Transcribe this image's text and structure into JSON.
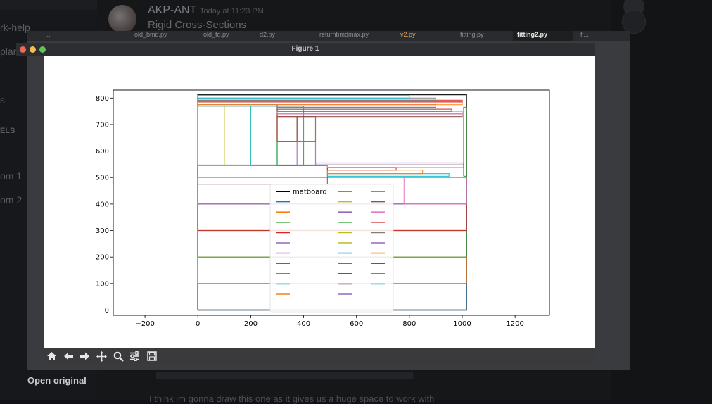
{
  "background": {
    "channels": [
      {
        "label": "rk-help"
      },
      {
        "label": "planni"
      },
      {
        "label": "s"
      },
      {
        "label": "ELS"
      },
      {
        "label": "om 1"
      },
      {
        "label": "om 2"
      }
    ],
    "message": {
      "username": "AKP-ANT",
      "timestamp": "Today at 11:23 PM",
      "text": "Rigid Cross-Sections",
      "followup": "I think im gonna draw this one as it gives us a huge space to work with"
    },
    "open_original": "Open original"
  },
  "editor": {
    "tabs": [
      "...",
      "old_bmd.py",
      "old_fd.py",
      "d2.py",
      "returnbmdmax.py",
      "v2.py",
      "fitting.py",
      "fitting2.py",
      "fi..."
    ]
  },
  "window": {
    "title": "Figure 1",
    "traffic_colors": [
      "#ee6a5f",
      "#f5bf4f",
      "#61c554"
    ]
  },
  "toolbar": {
    "buttons": [
      "home-icon",
      "back-icon",
      "forward-icon",
      "pan-icon",
      "zoom-icon",
      "configure-icon",
      "save-icon"
    ]
  },
  "chart_data": {
    "type": "line",
    "title": "",
    "xlabel": "",
    "ylabel": "",
    "xlim": [
      -320,
      1330
    ],
    "ylim": [
      -20,
      830
    ],
    "xticks": [
      -200,
      0,
      200,
      400,
      600,
      800,
      1000,
      1200
    ],
    "yticks": [
      0,
      100,
      200,
      300,
      400,
      500,
      600,
      700,
      800
    ],
    "legend_placement": "lower center",
    "legend_labels": [
      "matboard"
    ],
    "colors": [
      "#1f77b4",
      "#ff7f0e",
      "#2ca02c",
      "#d62728",
      "#9467bd",
      "#8c564b",
      "#e377c2",
      "#7f7f7f",
      "#bcbd22",
      "#17becf"
    ],
    "series": [
      {
        "name": "matboard",
        "color": "#000000",
        "x": [
          0,
          1016,
          1016,
          0,
          0
        ],
        "y": [
          0,
          0,
          813,
          813,
          0
        ]
      },
      {
        "color": "#1f77b4",
        "x": [
          0,
          1016,
          1016,
          0,
          0
        ],
        "y": [
          0,
          0,
          100,
          100,
          0
        ]
      },
      {
        "color": "#ff7f0e",
        "x": [
          0,
          1016,
          1016,
          0,
          0
        ],
        "y": [
          100,
          100,
          200,
          200,
          100
        ]
      },
      {
        "color": "#2ca02c",
        "x": [
          0,
          1016,
          1016,
          0,
          0
        ],
        "y": [
          200,
          200,
          300,
          300,
          200
        ]
      },
      {
        "color": "#d62728",
        "x": [
          0,
          1016,
          1016,
          0,
          0
        ],
        "y": [
          300,
          300,
          400,
          400,
          300
        ]
      },
      {
        "color": "#9467bd",
        "x": [
          0,
          1016,
          1016,
          0,
          0
        ],
        "y": [
          400,
          400,
          500,
          500,
          400
        ]
      },
      {
        "color": "#e377c2",
        "x": [
          780,
          1016,
          1016,
          780,
          780
        ],
        "y": [
          400,
          400,
          500,
          500,
          400
        ]
      },
      {
        "color": "#8c564b",
        "x": [
          0,
          490,
          490,
          0,
          0
        ],
        "y": [
          475,
          475,
          545,
          545,
          475
        ]
      },
      {
        "color": "#7f7f7f",
        "x": [
          0,
          490,
          490,
          0,
          0
        ],
        "y": [
          545,
          545,
          547,
          547,
          545
        ]
      },
      {
        "color": "#17becf",
        "x": [
          490,
          950,
          950,
          490,
          490
        ],
        "y": [
          505,
          505,
          515,
          515,
          505
        ]
      },
      {
        "color": "#ff7f0e",
        "x": [
          490,
          850,
          850,
          490,
          490
        ],
        "y": [
          515,
          515,
          528,
          528,
          515
        ]
      },
      {
        "color": "#d62728",
        "x": [
          490,
          750,
          750,
          490,
          490
        ],
        "y": [
          528,
          528,
          538,
          538,
          528
        ]
      },
      {
        "color": "#bcbd22",
        "x": [
          490,
          1005,
          1005,
          490,
          490
        ],
        "y": [
          538,
          538,
          548,
          548,
          538
        ]
      },
      {
        "color": "#9467bd",
        "x": [
          450,
          1005,
          1005,
          450,
          450
        ],
        "y": [
          548,
          548,
          555,
          555,
          548
        ]
      },
      {
        "color": "#2ca02c",
        "x": [
          1005,
          1016,
          1016,
          1005,
          1005
        ],
        "y": [
          505,
          505,
          765,
          765,
          505
        ]
      },
      {
        "color": "#bcbd22",
        "x": [
          0,
          100,
          100,
          0,
          0
        ],
        "y": [
          545,
          545,
          770,
          770,
          545
        ]
      },
      {
        "color": "#bcbd22",
        "x": [
          100,
          200,
          200,
          100,
          100
        ],
        "y": [
          545,
          545,
          770,
          770,
          545
        ]
      },
      {
        "color": "#17becf",
        "x": [
          200,
          300,
          300,
          200,
          200
        ],
        "y": [
          545,
          545,
          770,
          770,
          545
        ]
      },
      {
        "color": "#2ca02c",
        "x": [
          300,
          400,
          400,
          300,
          300
        ],
        "y": [
          545,
          545,
          770,
          770,
          545
        ]
      },
      {
        "color": "#d62728",
        "x": [
          300,
          375,
          375,
          300,
          300
        ],
        "y": [
          635,
          635,
          730,
          730,
          635
        ]
      },
      {
        "color": "#8c564b",
        "x": [
          375,
          445,
          445,
          375,
          375
        ],
        "y": [
          635,
          635,
          730,
          730,
          635
        ]
      },
      {
        "color": "#9467bd",
        "x": [
          375,
          445,
          445,
          375,
          375
        ],
        "y": [
          545,
          545,
          635,
          635,
          545
        ]
      },
      {
        "color": "#1f77b4",
        "x": [
          0,
          300,
          300,
          0,
          0
        ],
        "y": [
          770,
          770,
          775,
          775,
          770
        ]
      },
      {
        "color": "#8c564b",
        "x": [
          300,
          1000,
          1000,
          300,
          300
        ],
        "y": [
          730,
          730,
          740,
          740,
          730
        ]
      },
      {
        "color": "#e377c2",
        "x": [
          300,
          1000,
          1000,
          300,
          300
        ],
        "y": [
          740,
          740,
          750,
          750,
          740
        ]
      },
      {
        "color": "#d62728",
        "x": [
          300,
          960,
          960,
          300,
          300
        ],
        "y": [
          750,
          750,
          758,
          758,
          750
        ]
      },
      {
        "color": "#7f7f7f",
        "x": [
          300,
          900,
          900,
          300,
          300
        ],
        "y": [
          758,
          758,
          765,
          765,
          758
        ]
      },
      {
        "color": "#9467bd",
        "x": [
          300,
          900,
          900,
          300,
          300
        ],
        "y": [
          765,
          765,
          775,
          775,
          765
        ]
      },
      {
        "color": "#ff7f0e",
        "x": [
          0,
          1000,
          1000,
          0,
          0
        ],
        "y": [
          775,
          775,
          785,
          785,
          775
        ]
      },
      {
        "color": "#d62728",
        "x": [
          0,
          1000,
          1000,
          0,
          0
        ],
        "y": [
          785,
          785,
          792,
          792,
          785
        ]
      },
      {
        "color": "#7f7f7f",
        "x": [
          0,
          900,
          900,
          0,
          0
        ],
        "y": [
          792,
          792,
          800,
          800,
          792
        ]
      },
      {
        "color": "#17becf",
        "x": [
          0,
          800,
          800,
          0,
          0
        ],
        "y": [
          800,
          800,
          810,
          810,
          800
        ]
      }
    ]
  }
}
